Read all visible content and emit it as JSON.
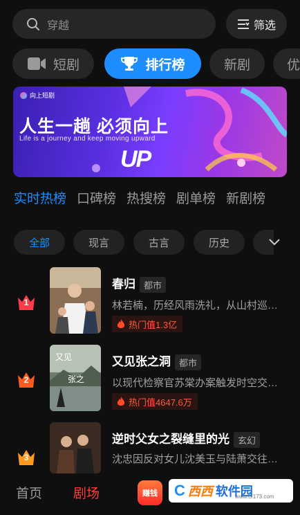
{
  "search": {
    "placeholder": "穿越",
    "filter_label": "筛选"
  },
  "categories": [
    {
      "label": "短剧",
      "icon": "video-camera-icon"
    },
    {
      "label": "排行榜",
      "icon": "trophy-icon"
    },
    {
      "label": "新剧"
    },
    {
      "label": "优"
    }
  ],
  "banner": {
    "brand": "向上短剧",
    "headline": "人生一趟  必须向上",
    "subline": "Life is a journey and  keep moving upward",
    "logo_text": "UP"
  },
  "rank_tabs": [
    "实时热榜",
    "口碑榜",
    "热搜榜",
    "剧单榜",
    "新剧榜"
  ],
  "genre_chips": [
    "全部",
    "现言",
    "古言",
    "历史"
  ],
  "items": [
    {
      "rank": "1",
      "title": "春归",
      "tag": "都市",
      "desc": "林若楠，历经风雨洗礼，从山村巡…",
      "hot": "热门值1.3亿",
      "rank_color": "#ff3b4a"
    },
    {
      "rank": "2",
      "title": "又见张之洞",
      "tag": "都市",
      "desc": "以现代检察官苏棠办案触发时空交…",
      "hot": "热门值4647.6万",
      "rank_color": "#ff5a1f"
    },
    {
      "rank": "3",
      "title": "逆时父女之裂缝里的光",
      "tag": "玄幻",
      "desc": "沈忠因反对女儿沈美玉与陆萧交往…",
      "rank_color": "#ff9a1f"
    }
  ],
  "nav": {
    "home": "首页",
    "theater": "剧场",
    "earn": "赚钱"
  },
  "watermark": {
    "part1": "西西",
    "part2": "软件园",
    "url": "www.cr173.com"
  },
  "colors": {
    "accent": "#1e8dff",
    "hot": "#ff5a3c",
    "active_nav": "#ff3b3b"
  }
}
